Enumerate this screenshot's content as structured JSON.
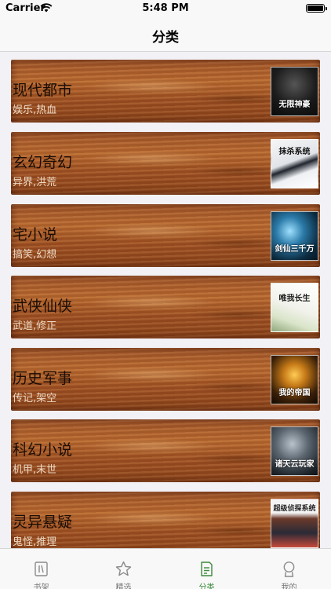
{
  "status_bar": {
    "carrier": "Carrier",
    "time": "5:48 PM",
    "icons": [
      "wifi-icon",
      "battery-icon"
    ]
  },
  "nav": {
    "title": "分类"
  },
  "categories": [
    {
      "name": "现代都市",
      "tags": "娱乐,热血",
      "cover_text": "无限神豪"
    },
    {
      "name": "玄幻奇幻",
      "tags": "异界,洪荒",
      "cover_text": "抹杀系统"
    },
    {
      "name": "宅小说",
      "tags": "搞笑,幻想",
      "cover_text": "剑仙三千万"
    },
    {
      "name": "武侠仙侠",
      "tags": "武道,修正",
      "cover_text": "唯我长生"
    },
    {
      "name": "历史军事",
      "tags": "传记,架空",
      "cover_text": "我的帝国"
    },
    {
      "name": "科幻小说",
      "tags": "机甲,末世",
      "cover_text": "诸天云玩家"
    },
    {
      "name": "灵异悬疑",
      "tags": "鬼怪,推理",
      "cover_text": "超级侦探系统"
    }
  ],
  "tabs": [
    {
      "label": "书架",
      "icon": "bookshelf-icon",
      "active": false
    },
    {
      "label": "精选",
      "icon": "star-icon",
      "active": false
    },
    {
      "label": "分类",
      "icon": "category-icon",
      "active": true
    },
    {
      "label": "我的",
      "icon": "profile-icon",
      "active": false
    }
  ],
  "colors": {
    "active_tab": "#3b8a3b",
    "inactive_tab": "#777777",
    "background": "#f2f1f6"
  }
}
